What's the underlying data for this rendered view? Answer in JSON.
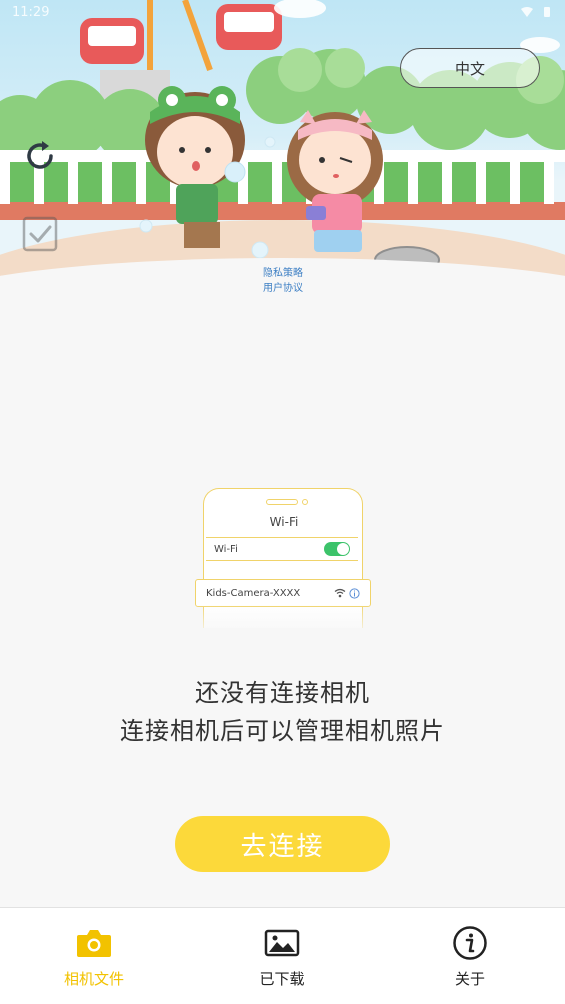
{
  "status_bar": {
    "time": "11:29"
  },
  "header": {
    "language_label": "中文",
    "privacy_policy": "隐私策略",
    "user_agreement": "用户协议"
  },
  "wifi_illustration": {
    "title": "Wi-Fi",
    "wifi_label": "Wi-Fi",
    "network_name": "Kids-Camera-XXXX"
  },
  "main": {
    "message_line1": "还没有连接相机",
    "message_line2": "连接相机后可以管理相机照片",
    "connect_button": "去连接"
  },
  "tabbar": {
    "tabs": [
      {
        "label": "相机文件",
        "icon": "camera-icon",
        "active": true
      },
      {
        "label": "已下载",
        "icon": "image-icon",
        "active": false
      },
      {
        "label": "关于",
        "icon": "info-icon",
        "active": false
      }
    ]
  },
  "colors": {
    "accent": "#fcd93a",
    "active_tab": "#f2c200",
    "toggle_on": "#3cc36a",
    "link": "#3d7fc4"
  }
}
